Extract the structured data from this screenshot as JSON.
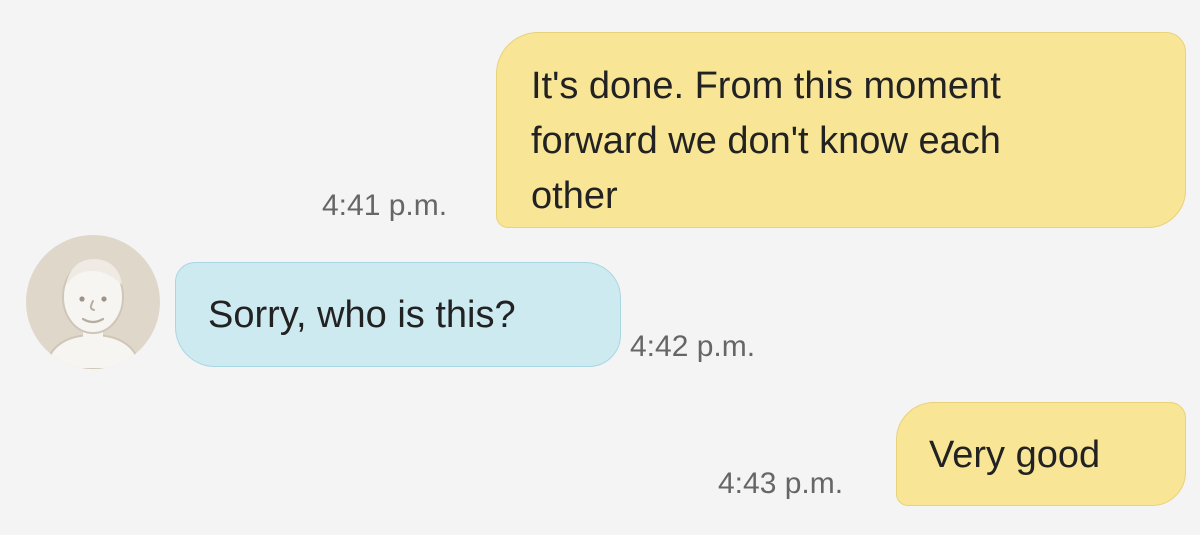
{
  "messages": [
    {
      "direction": "outgoing",
      "lines": [
        "It's done. From this moment",
        "forward we don't know each",
        "other"
      ],
      "time": "4:41 p.m."
    },
    {
      "direction": "incoming",
      "lines": [
        "Sorry, who is this?"
      ],
      "time": "4:42 p.m."
    },
    {
      "direction": "outgoing",
      "lines": [
        "Very good"
      ],
      "time": "4:43 p.m."
    }
  ],
  "avatar": {
    "icon": "person-placeholder-icon"
  },
  "colors": {
    "background": "#f4f4f4",
    "outgoing_bubble": "#f8e596",
    "incoming_bubble": "#cdeaf1",
    "avatar_bg": "#dfd7ca",
    "timestamp_text": "#666666"
  }
}
